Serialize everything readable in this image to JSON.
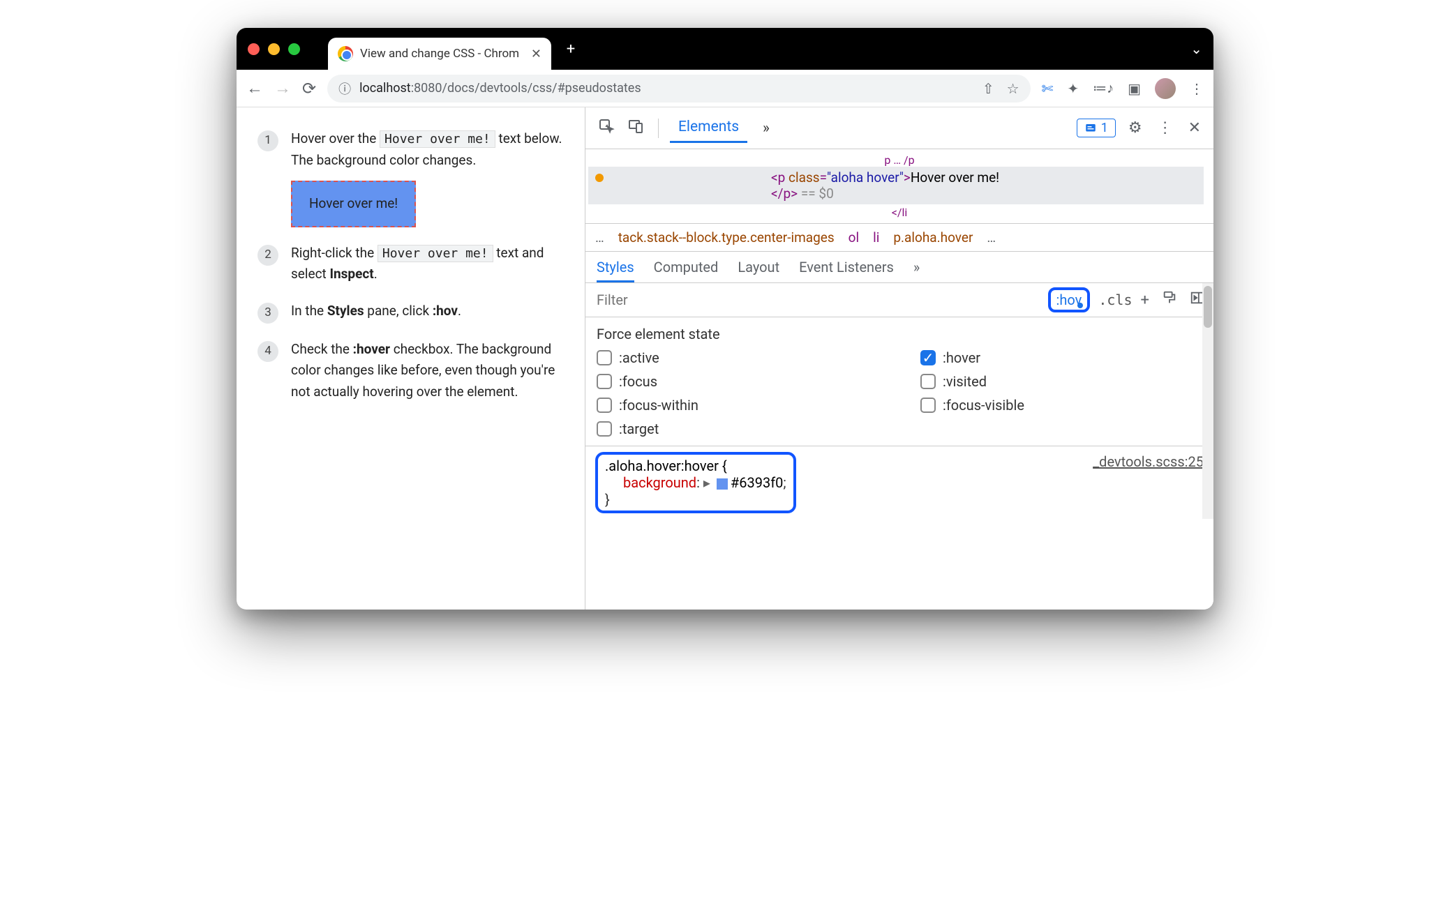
{
  "window": {
    "tab_title": "View and change CSS - Chrom"
  },
  "address": {
    "info_icon": "ⓘ",
    "host_dim": "localhost",
    "port_path": ":8080/docs/devtools/css/#pseudostates"
  },
  "page": {
    "step1_a": "Hover over the ",
    "step1_code": "Hover over me!",
    "step1_b": " text below. The background color changes.",
    "hover_box": "Hover over me!",
    "step2_a": "Right-click the ",
    "step2_code": "Hover over me!",
    "step2_b": " text and select ",
    "step2_bold": "Inspect",
    "step2_c": ".",
    "step3_a": "In the ",
    "step3_bold": "Styles",
    "step3_b": " pane, click ",
    "step3_bold2": ":hov",
    "step3_c": ".",
    "step4_a": "Check the ",
    "step4_bold": ":hover",
    "step4_b": " checkbox. The background color changes like before, even though you're not actually hovering over the element."
  },
  "devtools": {
    "tabs": {
      "elements": "Elements",
      "more": "»"
    },
    "issues_count": "1",
    "dom": {
      "open_p": "<p ",
      "class_attr": "class",
      "eq": "=",
      "class_val": "\"aloha hover\"",
      "gt": ">",
      "text": "Hover over me!",
      "close_p": "</p>",
      "eqdollar": " == $0",
      "li_close_hint": "</li"
    },
    "crumbs": {
      "ell1": "…",
      "c1": "tack.stack--block.type.center-images",
      "c2": "ol",
      "c3": "li",
      "c4": "p.aloha.hover",
      "ell2": "…"
    },
    "styles_tabs": {
      "styles": "Styles",
      "computed": "Computed",
      "layout": "Layout",
      "events": "Event Listeners",
      "more": "»"
    },
    "filter": {
      "placeholder": "Filter",
      "hov": ":hov",
      "cls": ".cls"
    },
    "force": {
      "title": "Force element state",
      "active": ":active",
      "hover": ":hover",
      "focus": ":focus",
      "visited": ":visited",
      "focus_within": ":focus-within",
      "focus_visible": ":focus-visible",
      "target": ":target"
    },
    "rule": {
      "selector": ".aloha.hover:hover {",
      "prop": "background",
      "colon": ":",
      "tri": "▸",
      "value": "#6393f0",
      "semi": ";",
      "close": "}",
      "source": "_devtools.scss:25"
    }
  }
}
